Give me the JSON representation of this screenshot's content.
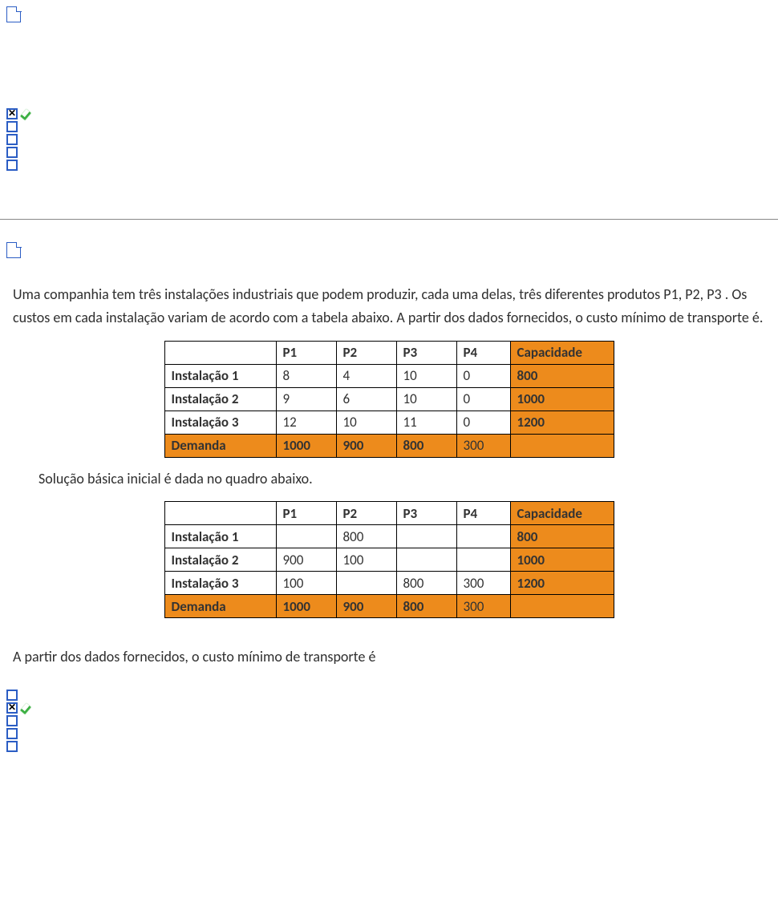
{
  "q1": {
    "options": [
      {
        "checked": true,
        "correct": true
      },
      {
        "checked": false,
        "correct": false
      },
      {
        "checked": false,
        "correct": false
      },
      {
        "checked": false,
        "correct": false
      },
      {
        "checked": false,
        "correct": false
      }
    ]
  },
  "q2": {
    "intro": "Uma companhia tem três instalações industriais que podem produzir, cada uma delas, três diferentes produtos P1, P2, P3 . Os custos  em cada instalação variam de acordo com a tabela abaixo. A partir dos dados fornecidos, o custo mínimo de transporte é.",
    "table1": {
      "headers": {
        "blank": "",
        "p1": "P1",
        "p2": "P2",
        "p3": "P3",
        "p4": "P4",
        "cap": "Capacidade"
      },
      "rows": [
        {
          "label": "Instalação 1",
          "p1": "8",
          "p2": "4",
          "p3": "10",
          "p4": "0",
          "cap": "800"
        },
        {
          "label": "Instalação 2",
          "p1": "9",
          "p2": "6",
          "p3": "10",
          "p4": "0",
          "cap": "1000"
        },
        {
          "label": "Instalação 3",
          "p1": "12",
          "p2": "10",
          "p3": "11",
          "p4": "0",
          "cap": "1200"
        }
      ],
      "demand": {
        "label": "Demanda",
        "p1": "1000",
        "p2": "900",
        "p3": "800",
        "p4": "300",
        "cap": ""
      }
    },
    "mid_text": "Solução básica inicial é dada no quadro abaixo.",
    "table2": {
      "headers": {
        "blank": "",
        "p1": "P1",
        "p2": "P2",
        "p3": "P3",
        "p4": "P4",
        "cap": "Capacidade"
      },
      "rows": [
        {
          "label": "Instalação 1",
          "p1": "",
          "p2": "800",
          "p3": "",
          "p4": "",
          "cap": "800"
        },
        {
          "label": "Instalação 2",
          "p1": "900",
          "p2": "100",
          "p3": "",
          "p4": "",
          "cap": "1000"
        },
        {
          "label": "Instalação 3",
          "p1": "100",
          "p2": "",
          "p3": "800",
          "p4": "300",
          "cap": "1200"
        }
      ],
      "demand": {
        "label": "Demanda",
        "p1": "1000",
        "p2": "900",
        "p3": "800",
        "p4": "300",
        "cap": ""
      }
    },
    "outro": "A partir dos dados fornecidos, o custo mínimo de transporte é",
    "options": [
      {
        "checked": false,
        "correct": false
      },
      {
        "checked": true,
        "correct": true
      },
      {
        "checked": false,
        "correct": false
      },
      {
        "checked": false,
        "correct": false
      },
      {
        "checked": false,
        "correct": false
      }
    ]
  },
  "x_mark": "✕"
}
